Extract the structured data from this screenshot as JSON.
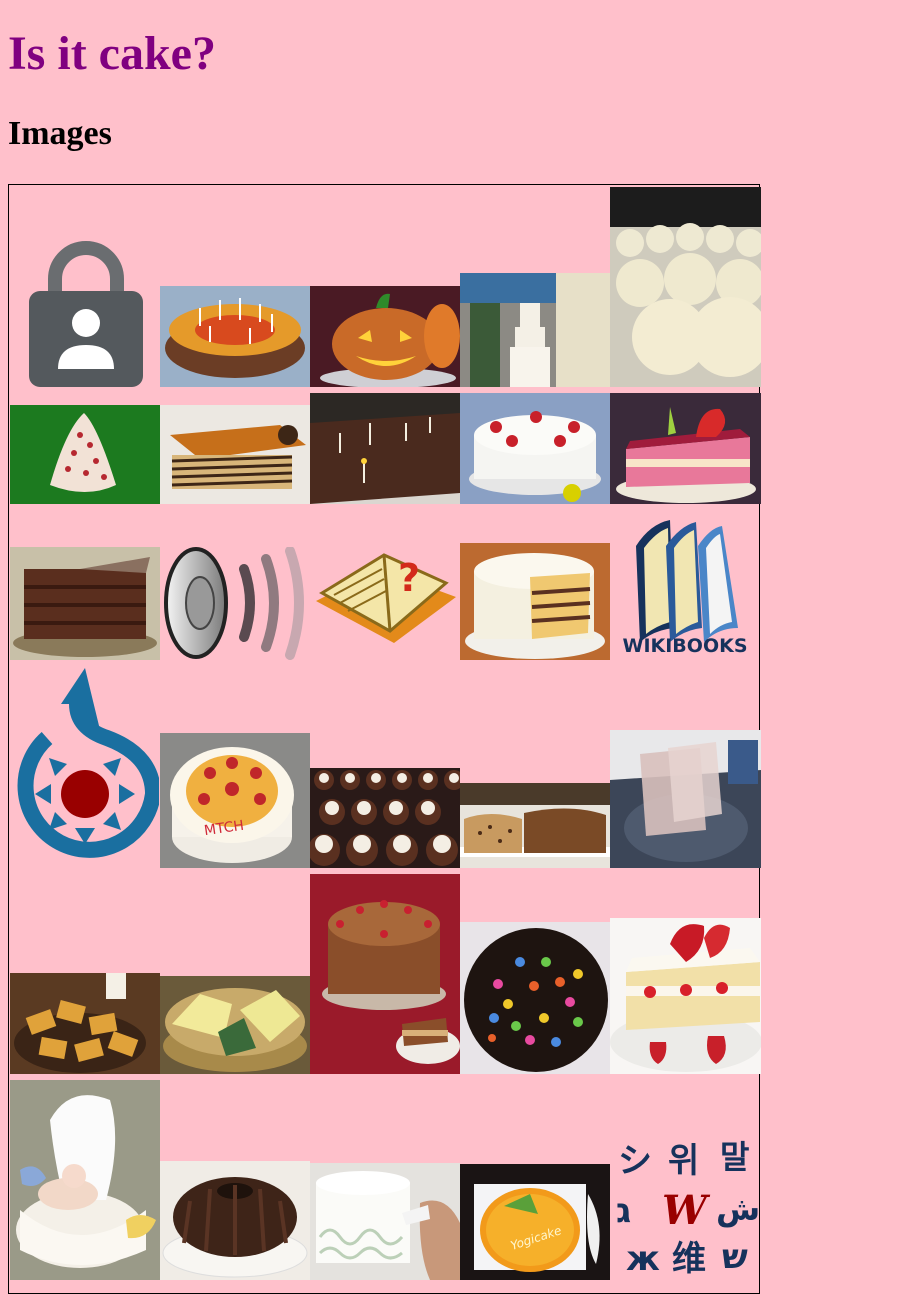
{
  "page": {
    "title": "Is it cake?",
    "subtitle": "Images"
  },
  "colors": {
    "background": "#ffc0cb",
    "title": "#800080",
    "commons_blue": "#1a6fa0",
    "commons_red": "#990000",
    "wikibooks_navy": "#16325c"
  },
  "gallery": [
    {
      "name": "lock-icon",
      "kind": "lock"
    },
    {
      "name": "birthday-cake-candles",
      "kind": "photo"
    },
    {
      "name": "pumpkin-cake",
      "kind": "photo"
    },
    {
      "name": "tiered-white-cakes",
      "kind": "photo"
    },
    {
      "name": "cake-balls",
      "kind": "photo"
    },
    {
      "name": "cone-cake-green",
      "kind": "photo"
    },
    {
      "name": "layered-dobos-cake",
      "kind": "photo"
    },
    {
      "name": "sheet-cake-candles",
      "kind": "photo"
    },
    {
      "name": "strawberry-cream-cake",
      "kind": "photo"
    },
    {
      "name": "strawberry-cake-slice",
      "kind": "photo"
    },
    {
      "name": "chocolate-layer-cake",
      "kind": "photo"
    },
    {
      "name": "speaker-icon",
      "kind": "speaker"
    },
    {
      "name": "wiktionary-book-icon",
      "kind": "book"
    },
    {
      "name": "sliced-layer-cake",
      "kind": "photo"
    },
    {
      "name": "wikibooks-logo",
      "kind": "wikibooks",
      "label": "WIKIBOOKS"
    },
    {
      "name": "wikimedia-commons-logo",
      "kind": "commons"
    },
    {
      "name": "fruit-topped-cake",
      "kind": "photo"
    },
    {
      "name": "cupcakes-tray",
      "kind": "photo"
    },
    {
      "name": "pound-cake-loaf",
      "kind": "photo"
    },
    {
      "name": "cake-mix-bag",
      "kind": "photo"
    },
    {
      "name": "baklava-pieces",
      "kind": "photo"
    },
    {
      "name": "steamed-cake-basket",
      "kind": "photo"
    },
    {
      "name": "chocolate-frosted-cake",
      "kind": "photo"
    },
    {
      "name": "candy-topped-chocolate-cake",
      "kind": "photo"
    },
    {
      "name": "strawberry-shortcake-slice",
      "kind": "photo"
    },
    {
      "name": "baby-cradle-cake",
      "kind": "photo"
    },
    {
      "name": "bundt-cake",
      "kind": "photo"
    },
    {
      "name": "piping-white-cake",
      "kind": "photo"
    },
    {
      "name": "mango-yogurt-cake",
      "kind": "photo"
    },
    {
      "name": "wikiquote-multilingual-logo",
      "kind": "multilingual",
      "glyphs": [
        "シ",
        "위",
        "말",
        "ג",
        "W",
        "ش",
        "ж",
        "维",
        "ש"
      ]
    }
  ]
}
